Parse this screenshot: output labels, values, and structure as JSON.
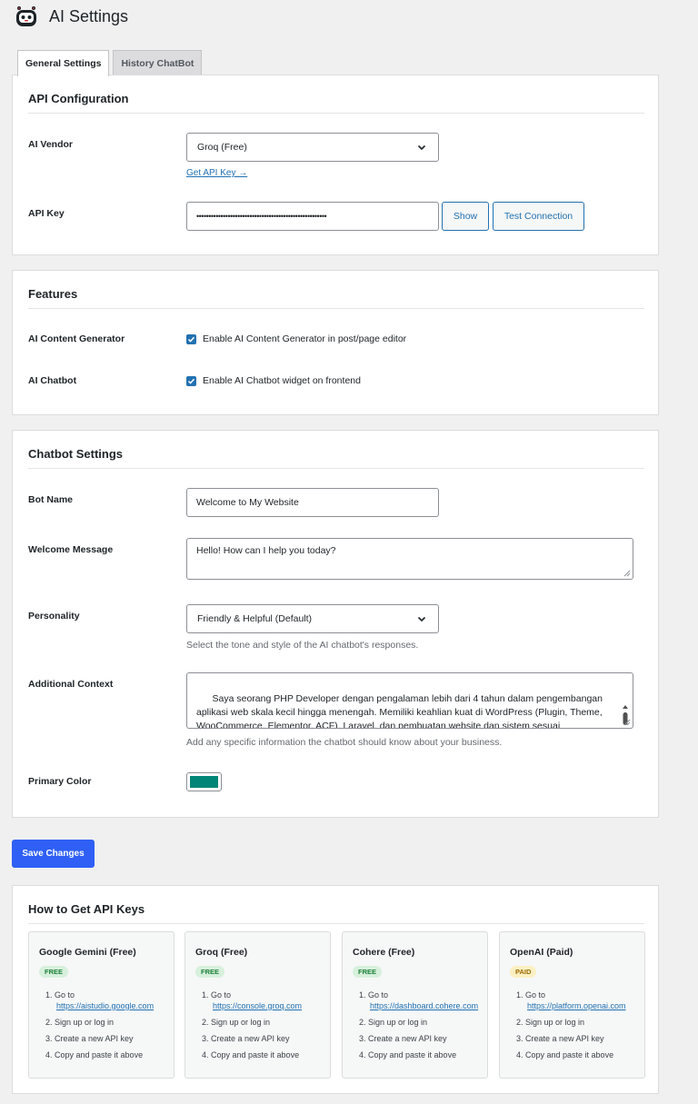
{
  "header": {
    "title": "AI Settings"
  },
  "tabs": [
    {
      "label": "General Settings",
      "active": true
    },
    {
      "label": "History ChatBot",
      "active": false
    }
  ],
  "api_config": {
    "title": "API Configuration",
    "vendor_label": "AI Vendor",
    "vendor_selected": "Groq (Free)",
    "get_key_link": "Get API Key →",
    "key_label": "API Key",
    "key_value": "••••••••••••••••••••••••••••••••••••••••••••••••••••••",
    "show_button": "Show",
    "test_button": "Test Connection"
  },
  "features": {
    "title": "Features",
    "content_gen_label": "AI Content Generator",
    "content_gen_checkbox": "Enable AI Content Generator in post/page editor",
    "chatbot_label": "AI Chatbot",
    "chatbot_checkbox": "Enable AI Chatbot widget on frontend"
  },
  "chatbot": {
    "title": "Chatbot Settings",
    "bot_name_label": "Bot Name",
    "bot_name_value": "Welcome to My Website",
    "welcome_label": "Welcome Message",
    "welcome_value": "Hello! How can I help you today?",
    "personality_label": "Personality",
    "personality_value": "Friendly & Helpful (Default)",
    "personality_desc": "Select the tone and style of the AI chatbot's responses.",
    "context_label": "Additional Context",
    "context_value": "Saya seorang PHP Developer dengan pengalaman lebih dari 4 tahun dalam pengembangan aplikasi web skala kecil hingga menengah. Memiliki keahlian kuat di WordPress (Plugin, Theme,\nWooCommerce, Elementor, ACF), Laravel, dan pembuatan website dan sistem sesuai kebutuhan.",
    "context_desc": "Add any specific information the chatbot should know about your business.",
    "color_label": "Primary Color",
    "color_value": "#008577"
  },
  "save_button": "Save Changes",
  "howto": {
    "title": "How to Get API Keys",
    "vendors": [
      {
        "name": "Google Gemini (Free)",
        "badge": "FREE",
        "badge_type": "free",
        "step1": "1. Go to",
        "url": "https://aistudio.google.com",
        "step2": "2. Sign up or log in",
        "step3": "3. Create a new API key",
        "step4": "4. Copy and paste it above"
      },
      {
        "name": "Groq (Free)",
        "badge": "FREE",
        "badge_type": "free",
        "step1": "1. Go to",
        "url": "https://console.groq.com",
        "step2": "2. Sign up or log in",
        "step3": "3. Create a new API key",
        "step4": "4. Copy and paste it above"
      },
      {
        "name": "Cohere (Free)",
        "badge": "FREE",
        "badge_type": "free",
        "step1": "1. Go to",
        "url": "https://dashboard.cohere.com",
        "step2": "2. Sign up or log in",
        "step3": "3. Create a new API key",
        "step4": "4. Copy and paste it above"
      },
      {
        "name": "OpenAI (Paid)",
        "badge": "PAID",
        "badge_type": "paid",
        "step1": "1. Go to",
        "url": "https://platform.openai.com",
        "step2": "2. Sign up or log in",
        "step3": "3. Create a new API key",
        "step4": "4. Copy and paste it above"
      }
    ]
  },
  "colors": {
    "accent": "#2271b1",
    "save_button": "#2f5ff5",
    "free_badge_bg": "#d7f0dc",
    "free_badge_text": "#1a7f37",
    "paid_badge_bg": "#fcf0c3",
    "paid_badge_text": "#996800"
  }
}
